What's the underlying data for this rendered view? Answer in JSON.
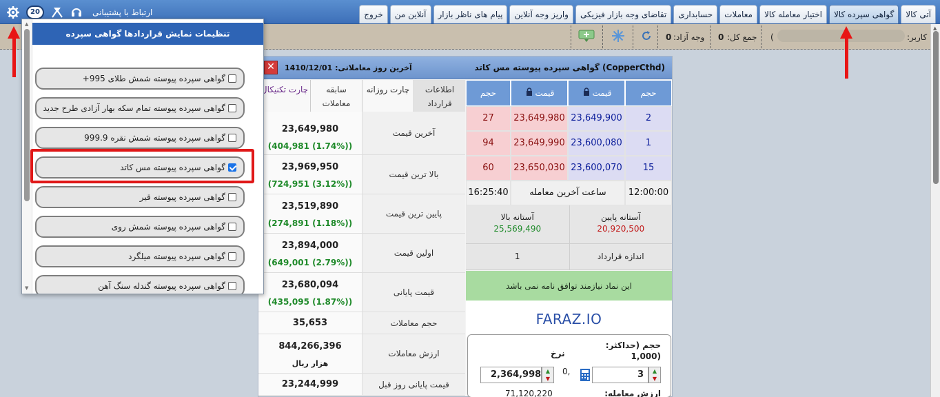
{
  "topbar": {
    "tabs": [
      {
        "label": "آتی کالا",
        "active": false
      },
      {
        "label": "گواهی سپرده کالا",
        "active": true
      },
      {
        "label": "اختیار معامله کالا",
        "active": false
      },
      {
        "label": "معاملات",
        "active": false
      },
      {
        "label": "حسابداری",
        "active": false
      },
      {
        "label": "تقاضای وجه بازار فیزیکی",
        "active": false
      },
      {
        "label": "واریز وجه آنلاین",
        "active": false
      },
      {
        "label": "پیام های ناظر بازار",
        "active": false
      },
      {
        "label": "آنلاین من",
        "active": false
      },
      {
        "label": "خروج",
        "active": false
      }
    ],
    "support_label": "ارتباط با پشتیبانی",
    "badge_count": "20"
  },
  "subbar": {
    "user_label": "کاربر:",
    "total_label": "جمع کل:",
    "total_value": "0",
    "cash_label": "وجه آزاد:",
    "cash_value": "0",
    "paren": ")"
  },
  "panel": {
    "title": "(CopperCthd) گواهی سپرده پیوسته مس کاتد",
    "last_day_label": "آخرین روز معاملاتی:",
    "last_day_value": "1410/12/01",
    "close_label": "✕"
  },
  "orderbook": {
    "headers": {
      "count": "حجم",
      "price": "قیمت",
      "vol": "حجم",
      "buy_count": "حجم",
      "sell_count": "حجم"
    },
    "header_labels": [
      "حجم",
      "قیمت",
      "قیمت",
      "حجم"
    ],
    "rows": [
      {
        "buy_count": "2",
        "buy_price": "23,649,900",
        "sell_price": "23,649,980",
        "sell_vol": "27"
      },
      {
        "buy_count": "1",
        "buy_price": "23,600,080",
        "sell_price": "23,649,990",
        "sell_vol": "94"
      },
      {
        "buy_count": "15",
        "buy_price": "23,600,070",
        "sell_price": "23,650,030",
        "sell_vol": "60"
      }
    ],
    "time_left": "12:00:00",
    "time_label": "ساعت آخرین معامله",
    "time_right": "16:25:40",
    "low_threshold_label": "آستانه پایین",
    "low_threshold_value": "20,920,500",
    "high_threshold_label": "آستانه بالا",
    "high_threshold_value": "25,569,490",
    "contract_size_label": "اندازه قرارداد",
    "contract_size_value": "1",
    "agreement_note": "این نماد نیازمند توافق نامه نمی باشد",
    "brand": "FARAZ.IO"
  },
  "order_form": {
    "volume_label": "حجم (حداکثر: (1,000",
    "volume_line1": "حجم (حداکثر:",
    "volume_line2": "(1,000",
    "price_label": "نرخ",
    "volume_value": "3",
    "price_value": "2,364,998",
    "decimal": "0,",
    "bottom_value": "71,120,220",
    "bottom_label": "ارزش معامله:"
  },
  "info_tabs": [
    {
      "label": "اطلاعات قرارداد",
      "active": true
    },
    {
      "label": "چارت روزانه",
      "active": false
    },
    {
      "label": "سابقه معاملات",
      "active": false
    },
    {
      "label": "چارت تکنیکال",
      "active": false
    }
  ],
  "stats": [
    {
      "label": "آخرین قیمت",
      "value": "23,649,980",
      "change": "(404,981 (1.74%))"
    },
    {
      "label": "بالا ترین قیمت",
      "value": "23,969,950",
      "change": "(724,951 (3.12%))"
    },
    {
      "label": "پایین ترین قیمت",
      "value": "23,519,890",
      "change": "(274,891 (1.18%))"
    },
    {
      "label": "اولین قیمت",
      "value": "23,894,000",
      "change": "(649,001 (2.79%))"
    },
    {
      "label": "قیمت پایانی",
      "value": "23,680,094",
      "change": "(435,095 (1.87%))"
    },
    {
      "label": "حجم معاملات",
      "value": "35,653",
      "change": ""
    },
    {
      "label": "ارزش معاملات",
      "value": "844,266,396",
      "change": "هزار ریال"
    },
    {
      "label": "قیمت پایانی روز قبل",
      "value": "23,244,999",
      "change": ""
    }
  ],
  "dropdown": {
    "title": "تنظیمات نمایش قراردادها گواهی سپرده",
    "items": [
      {
        "label": "گواهی سپرده پیوسته شمش طلای 995+",
        "checked": false
      },
      {
        "label": "گواهی سپرده پیوسته تمام سکه بهار آزادی طرح جدید",
        "checked": false
      },
      {
        "label": "گواهی سپرده پیوسته شمش نقره 999.9",
        "checked": false
      },
      {
        "label": "گواهی سپرده پیوسته مس کاتد",
        "checked": true
      },
      {
        "label": "گواهی سپرده پیوسته قیر",
        "checked": false
      },
      {
        "label": "گواهی سپرده پیوسته شمش روی",
        "checked": false
      },
      {
        "label": "گواهی سپرده پیوسته میلگرد",
        "checked": false
      },
      {
        "label": "گواهی سپرده پیوسته گندله سنگ آهن",
        "checked": false
      }
    ]
  },
  "colors": {
    "accent": "#2e64b5",
    "buy": "#0b1d9a",
    "sell": "#8a1111",
    "positive": "#1f8a2a",
    "annotation": "#e81515"
  },
  "icons": {
    "settings": "gear-icon",
    "support": "headset-icon",
    "satellite": "satellite-icon",
    "refresh": "refresh-icon",
    "calculator": "calculator-icon",
    "lock": "lock-icon"
  }
}
